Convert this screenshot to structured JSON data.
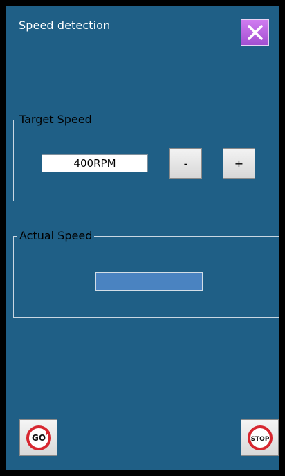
{
  "window": {
    "title": "Speed detection"
  },
  "target_speed": {
    "label": "Target Speed",
    "value": "400RPM",
    "decrement_label": "-",
    "increment_label": "+"
  },
  "actual_speed": {
    "label": "Actual Speed",
    "value": ""
  },
  "footer": {
    "go_label": "GO",
    "stop_label": "STOP"
  },
  "colors": {
    "background": "#1f5f86",
    "close_button": "#b563e2",
    "actual_field": "#4a83c1",
    "go_icon": "#d7262f",
    "stop_icon": "#d7262f"
  },
  "icons": {
    "close": "close-icon",
    "go": "go-icon",
    "stop": "stop-icon"
  }
}
